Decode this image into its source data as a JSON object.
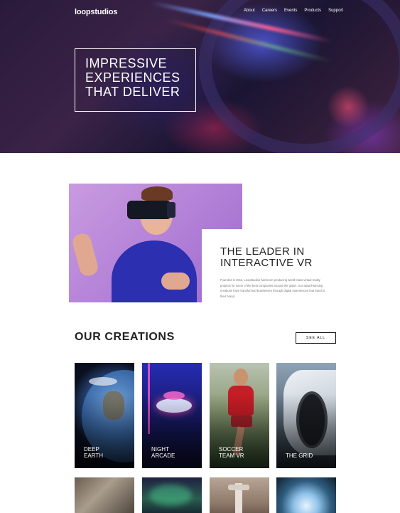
{
  "header": {
    "logo": "loopstudios",
    "nav": [
      "About",
      "Careers",
      "Events",
      "Products",
      "Support"
    ]
  },
  "hero": {
    "lines": [
      "IMPRESSIVE",
      "EXPERIENCES",
      "THAT DELIVER"
    ]
  },
  "intro": {
    "title_lines": [
      "THE LEADER IN",
      "INTERACTIVE VR"
    ],
    "text": "Founded in 2011, Loopstudios has been producing world-class virtual reality projects for some of the best companies around the globe. Our award-winning creations have transformed businesses through digital experiences that bond to their brand."
  },
  "creations": {
    "title": "OUR CREATIONS",
    "see_all": "SEE ALL",
    "items": [
      {
        "lines": [
          "DEEP",
          "EARTH"
        ]
      },
      {
        "lines": [
          "NIGHT",
          "ARCADE"
        ]
      },
      {
        "lines": [
          "SOCCER",
          "TEAM VR"
        ]
      },
      {
        "lines": [
          "THE GRID"
        ]
      }
    ]
  }
}
